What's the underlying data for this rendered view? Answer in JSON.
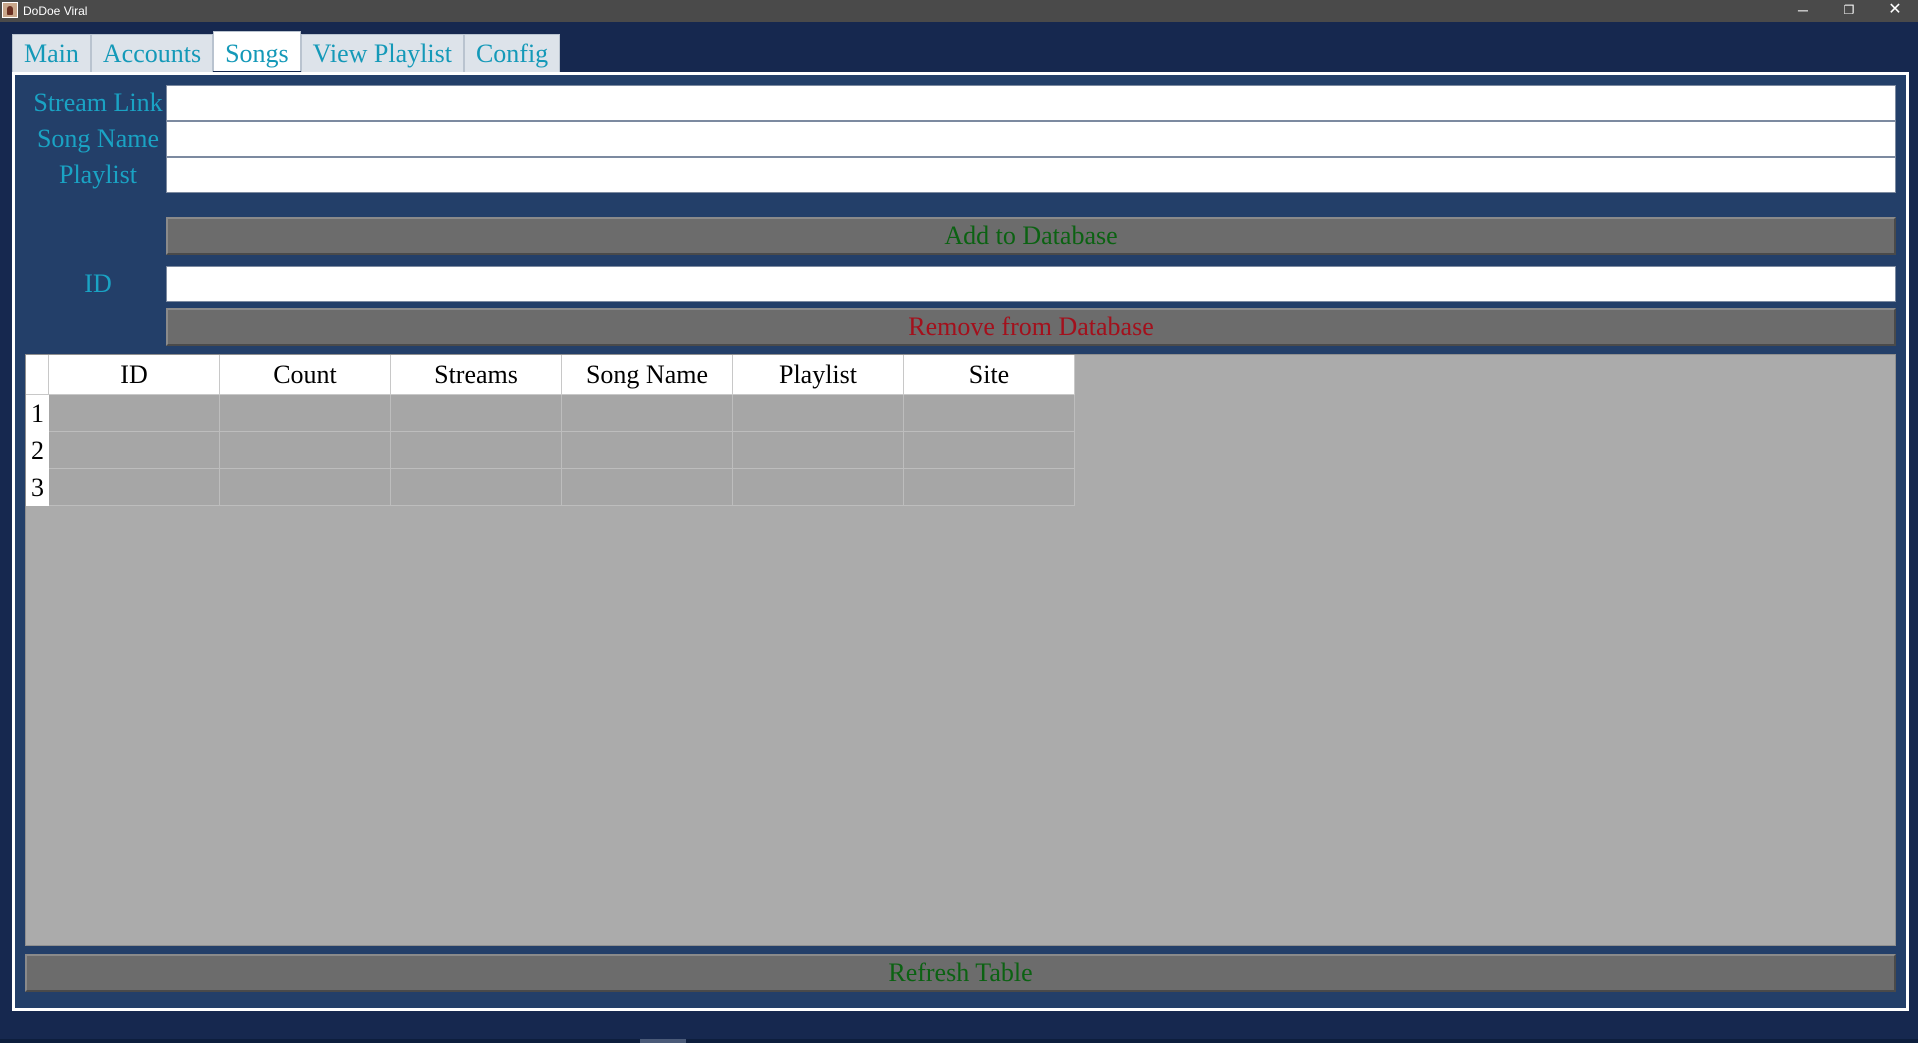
{
  "window": {
    "title": "DoDoe Viral",
    "minimize_glyph": "─",
    "maximize_glyph": "❐",
    "close_glyph": "✕"
  },
  "tabs": [
    {
      "label": "Main",
      "active": false
    },
    {
      "label": "Accounts",
      "active": false
    },
    {
      "label": "Songs",
      "active": true
    },
    {
      "label": "View Playlist",
      "active": false
    },
    {
      "label": "Config",
      "active": false
    }
  ],
  "form": {
    "stream_link_label": "Stream Link",
    "stream_link_value": "",
    "song_name_label": "Song Name",
    "song_name_value": "",
    "playlist_label": "Playlist",
    "playlist_value": "",
    "add_button": "Add to Database",
    "id_label": "ID",
    "id_value": "",
    "remove_button": "Remove from Database"
  },
  "table": {
    "columns": [
      "ID",
      "Count",
      "Streams",
      "Song Name",
      "Playlist",
      "Site"
    ],
    "row_numbers": [
      "1",
      "2",
      "3"
    ],
    "rows": [
      [
        "",
        "",
        "",
        "",
        "",
        ""
      ],
      [
        "",
        "",
        "",
        "",
        "",
        ""
      ],
      [
        "",
        "",
        "",
        "",
        "",
        ""
      ]
    ]
  },
  "refresh_button": "Refresh Table",
  "colors": {
    "background": "#16284f",
    "panel": "#233f69",
    "label_text": "#1aa3c4",
    "add_text": "#0b6212",
    "remove_text": "#a3101c",
    "button_bg": "#6c6c6c",
    "table_bg": "#ababab"
  }
}
